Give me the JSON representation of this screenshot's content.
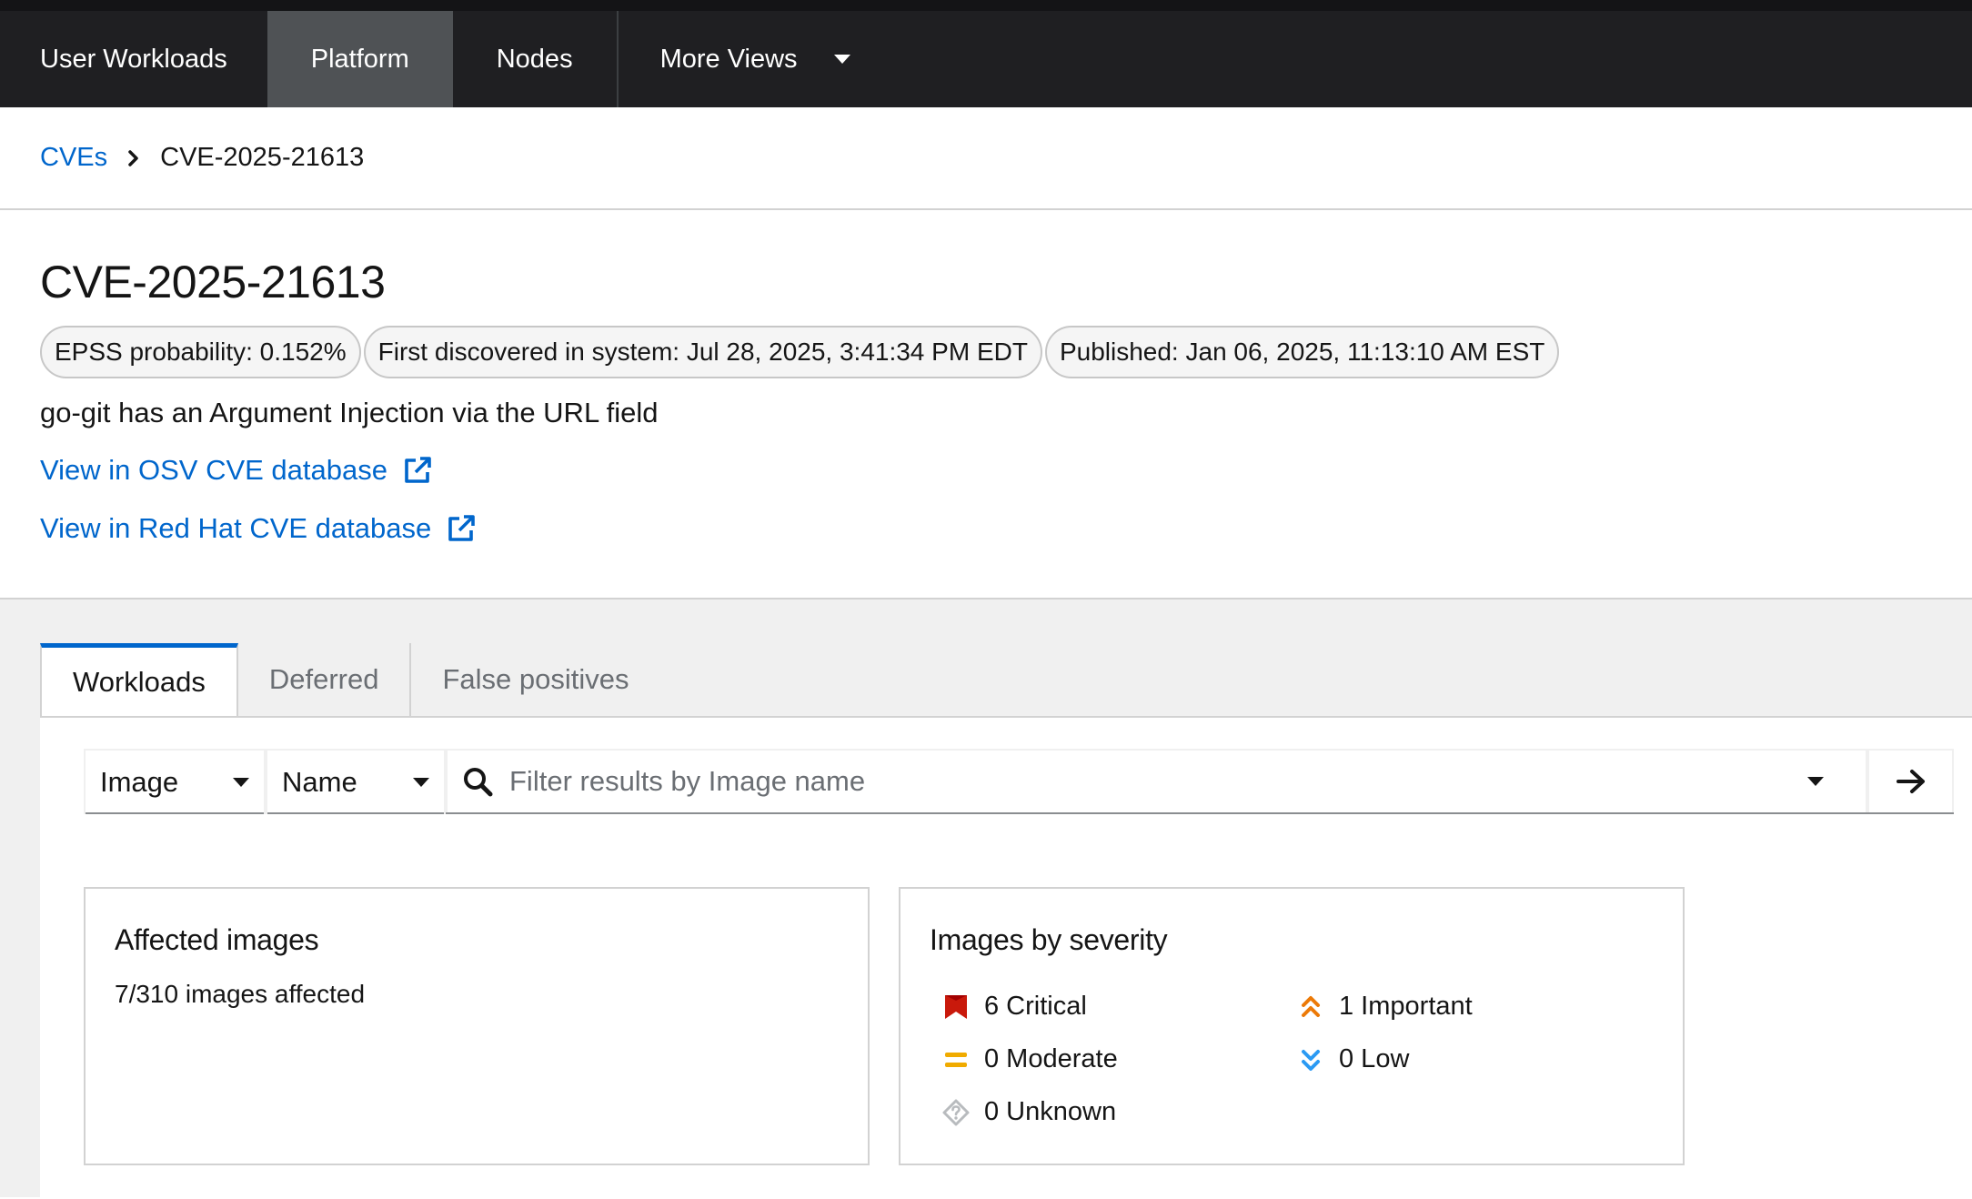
{
  "nav": {
    "items": [
      {
        "label": "User Workloads"
      },
      {
        "label": "Platform"
      },
      {
        "label": "Nodes"
      },
      {
        "label": "More Views"
      }
    ]
  },
  "breadcrumb": {
    "parent": "CVEs",
    "current": "CVE-2025-21613"
  },
  "cve": {
    "title": "CVE-2025-21613",
    "labels": {
      "epss": "EPSS probability: 0.152%",
      "first_discovered": "First discovered in system: Jul 28, 2025, 3:41:34 PM EDT",
      "published": "Published: Jan 06, 2025, 11:13:10 AM EST"
    },
    "summary": "go-git has an Argument Injection via the URL field",
    "links": {
      "osv": "View in OSV CVE database",
      "redhat": "View in Red Hat CVE database"
    }
  },
  "tabs": [
    {
      "label": "Workloads"
    },
    {
      "label": "Deferred"
    },
    {
      "label": "False positives"
    }
  ],
  "toolbar": {
    "entity_select": "Image",
    "attribute_select": "Name",
    "search_placeholder": "Filter results by Image name"
  },
  "affected_card": {
    "title": "Affected images",
    "body": "7/310 images affected"
  },
  "severity_card": {
    "title": "Images by severity",
    "critical": "6 Critical",
    "important": "1 Important",
    "moderate": "0 Moderate",
    "low": "0 Low",
    "unknown": "0 Unknown"
  },
  "colors": {
    "nav_bg": "#1f1f22",
    "nav_active": "#4f5255",
    "link": "#0066cc",
    "critical": "#c9190b",
    "important": "#ec7a08",
    "moderate": "#f0ab00",
    "low": "#2b9af3",
    "unknown": "#b8bbbe"
  },
  "icons": {
    "breadcrumb_separator": "chevron-right-icon",
    "external_link": "external-link-icon",
    "search": "search-icon",
    "go": "arrow-right-icon",
    "critical": "critical-flag-icon",
    "important": "double-chevron-up-icon",
    "moderate": "equals-icon",
    "low": "double-chevron-down-icon",
    "unknown": "unknown-diamond-icon"
  }
}
